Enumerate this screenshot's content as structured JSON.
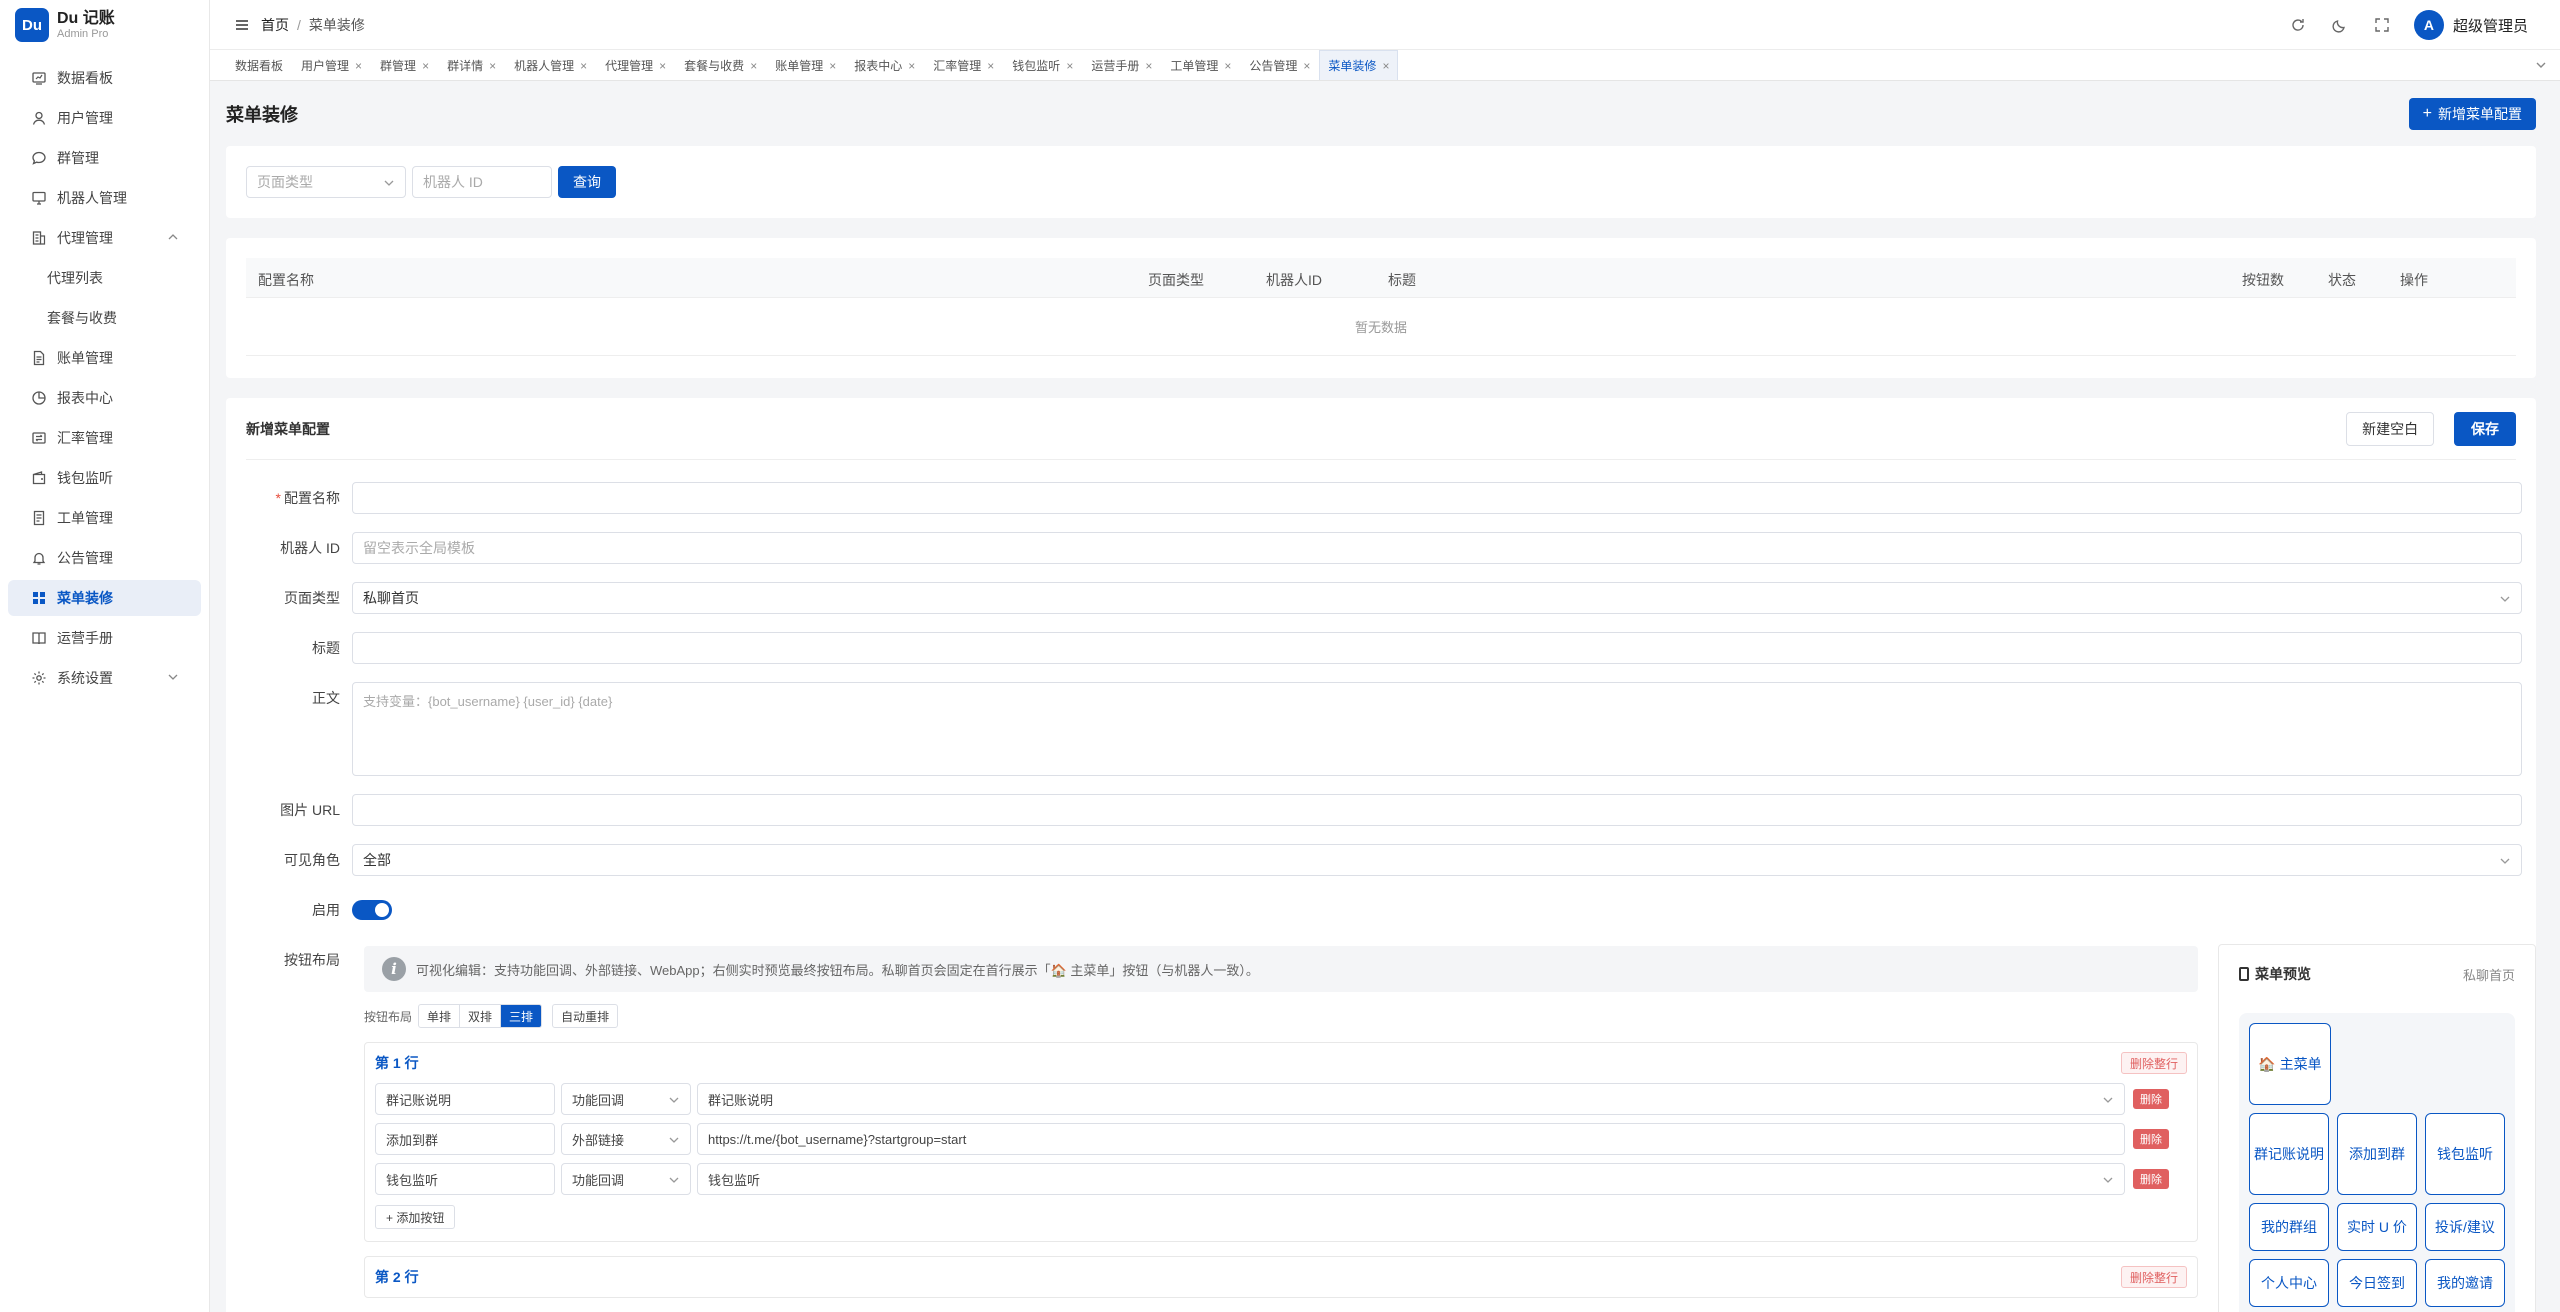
{
  "brand": {
    "logo": "Du",
    "name": "Du 记账",
    "sub": "Admin Pro"
  },
  "sidebar": {
    "items": [
      {
        "label": "数据看板",
        "icon": "dashboard-icon"
      },
      {
        "label": "用户管理",
        "icon": "user-icon"
      },
      {
        "label": "群管理",
        "icon": "chat-icon"
      },
      {
        "label": "机器人管理",
        "icon": "monitor-icon"
      },
      {
        "label": "代理管理",
        "icon": "building-icon",
        "expanded": true
      },
      {
        "label": "代理列表",
        "sub": true
      },
      {
        "label": "套餐与收费",
        "sub": true
      },
      {
        "label": "账单管理",
        "icon": "document-icon"
      },
      {
        "label": "报表中心",
        "icon": "pie-chart-icon"
      },
      {
        "label": "汇率管理",
        "icon": "exchange-icon"
      },
      {
        "label": "钱包监听",
        "icon": "wallet-icon"
      },
      {
        "label": "工单管理",
        "icon": "ticket-icon"
      },
      {
        "label": "公告管理",
        "icon": "bell-icon"
      },
      {
        "label": "菜单装修",
        "icon": "grid-icon",
        "active": true
      },
      {
        "label": "运营手册",
        "icon": "book-icon"
      },
      {
        "label": "系统设置",
        "icon": "gear-icon",
        "collapsible": true
      }
    ]
  },
  "header": {
    "breadcrumb_home": "首页",
    "breadcrumb_sep": "/",
    "breadcrumb_current": "菜单装修",
    "avatar": "A",
    "user": "超级管理员"
  },
  "tabs": [
    {
      "label": "数据看板",
      "closable": false
    },
    {
      "label": "用户管理",
      "closable": true
    },
    {
      "label": "群管理",
      "closable": true
    },
    {
      "label": "群详情",
      "closable": true
    },
    {
      "label": "机器人管理",
      "closable": true
    },
    {
      "label": "代理管理",
      "closable": true
    },
    {
      "label": "套餐与收费",
      "closable": true
    },
    {
      "label": "账单管理",
      "closable": true
    },
    {
      "label": "报表中心",
      "closable": true
    },
    {
      "label": "汇率管理",
      "closable": true
    },
    {
      "label": "钱包监听",
      "closable": true
    },
    {
      "label": "运营手册",
      "closable": true
    },
    {
      "label": "工单管理",
      "closable": true
    },
    {
      "label": "公告管理",
      "closable": true
    },
    {
      "label": "菜单装修",
      "closable": true,
      "active": true
    }
  ],
  "page": {
    "title": "菜单装修",
    "add_button": "新增菜单配置"
  },
  "search": {
    "page_type_placeholder": "页面类型",
    "bot_id_placeholder": "机器人 ID",
    "query_button": "查询"
  },
  "table": {
    "columns": [
      "配置名称",
      "页面类型",
      "机器人ID",
      "标题",
      "按钮数",
      "状态",
      "操作"
    ],
    "empty_text": "暂无数据"
  },
  "form": {
    "title": "新增菜单配置",
    "new_blank_button": "新建空白",
    "save_button": "保存",
    "config_name_label": "配置名称",
    "config_name_value": "",
    "bot_id_label": "机器人 ID",
    "bot_id_placeholder": "留空表示全局模板",
    "page_type_label": "页面类型",
    "page_type_value": "私聊首页",
    "title_label": "标题",
    "title_value": "",
    "body_label": "正文",
    "body_placeholder": "支持变量：{bot_username} {user_id} {date}",
    "image_label": "图片 URL",
    "image_value": "",
    "role_label": "可见角色",
    "role_value": "全部",
    "enabled_label": "启用",
    "enabled": true,
    "button_layout_label": "按钮布局"
  },
  "layout": {
    "info": "可视化编辑：支持功能回调、外部链接、WebApp；右侧实时预览最终按钮布局。私聊首页会固定在首行展示「🏠 主菜单」按钮（与机器人一致）。",
    "seg_label": "按钮布局",
    "segments": [
      "单排",
      "双排",
      "三排"
    ],
    "selected_segment": "三排",
    "auto_button": "自动重排",
    "delete_row_button": "删除整行",
    "add_button": "+ 添加按钮",
    "rows": [
      {
        "title": "第 1 行",
        "buttons": [
          {
            "name": "群记账说明",
            "type": "功能回调",
            "value": "群记账说明",
            "dropdown": true,
            "delete": "删除"
          },
          {
            "name": "添加到群",
            "type": "外部链接",
            "value": "https://t.me/{bot_username}?startgroup=start",
            "dropdown": false,
            "delete": "删除"
          },
          {
            "name": "钱包监听",
            "type": "功能回调",
            "value": "钱包监听",
            "dropdown": true,
            "delete": "删除"
          }
        ]
      },
      {
        "title": "第 2 行",
        "buttons": []
      }
    ]
  },
  "preview": {
    "title": "菜单预览",
    "sub": "私聊首页",
    "rows": [
      [
        "🏠 主菜单"
      ],
      [
        "群记账说明",
        "添加到群",
        "钱包监听"
      ],
      [
        "我的群组",
        "实时 U 价",
        "投诉/建议"
      ],
      [
        "个人中心",
        "今日签到",
        "我的邀请"
      ]
    ]
  },
  "colors": {
    "primary": "#0a57c4",
    "danger": "#e06060"
  }
}
